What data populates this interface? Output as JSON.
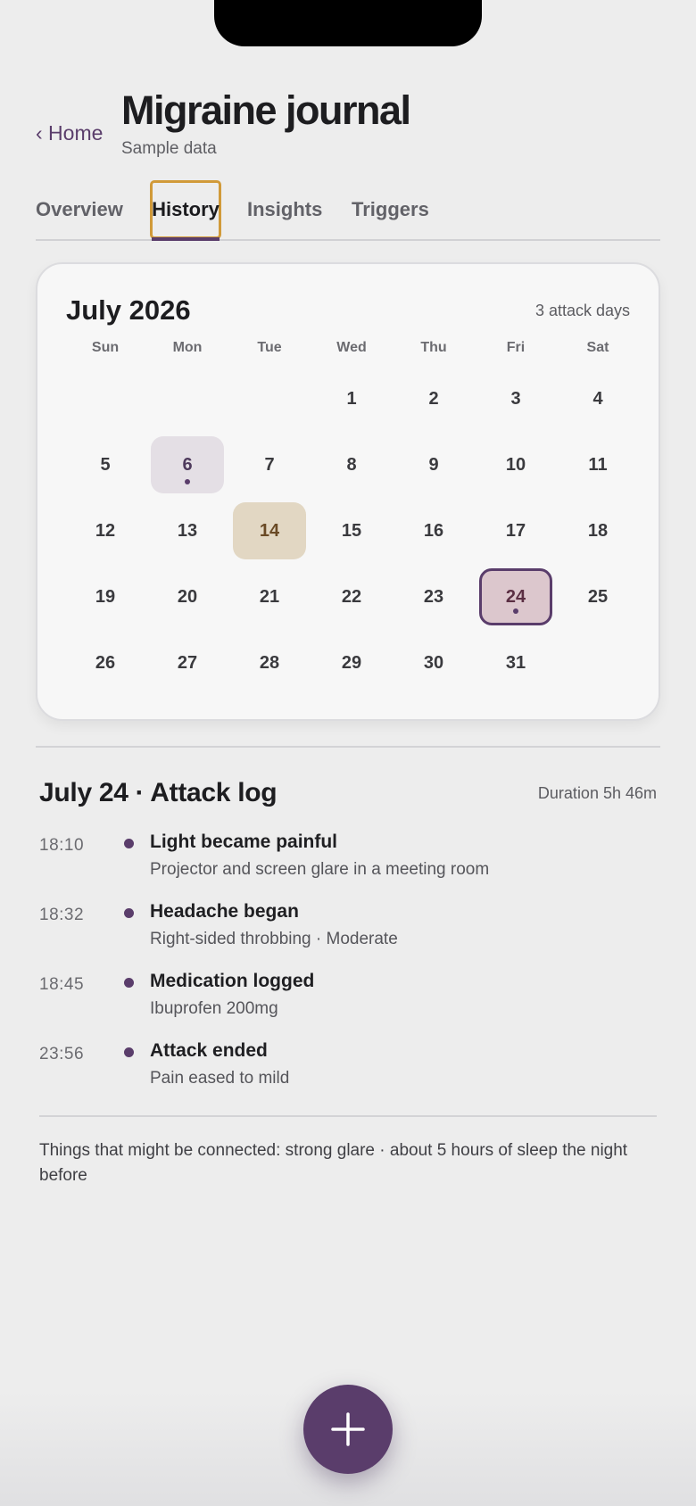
{
  "header": {
    "back_label": "‹ Home",
    "title": "Migraine journal",
    "subtitle": "Sample data"
  },
  "tabs": [
    {
      "label": "Overview",
      "active": false
    },
    {
      "label": "History",
      "active": true
    },
    {
      "label": "Insights",
      "active": false
    },
    {
      "label": "Triggers",
      "active": false
    }
  ],
  "calendar": {
    "month_label": "July 2026",
    "attack_count": "3 attack days",
    "weekdays": [
      "Sun",
      "Mon",
      "Tue",
      "Wed",
      "Thu",
      "Fri",
      "Sat"
    ],
    "weeks": [
      [
        "",
        "",
        "",
        "1",
        "2",
        "3",
        "4"
      ],
      [
        "5",
        "6",
        "7",
        "8",
        "9",
        "10",
        "11"
      ],
      [
        "12",
        "13",
        "14",
        "15",
        "16",
        "17",
        "18"
      ],
      [
        "19",
        "20",
        "21",
        "22",
        "23",
        "24",
        "25"
      ],
      [
        "26",
        "27",
        "28",
        "29",
        "30",
        "31",
        ""
      ]
    ],
    "attack_days": [
      "6",
      "24"
    ],
    "today": "14",
    "selected": "24"
  },
  "log": {
    "title": "July 24 · Attack log",
    "duration": "Duration 5h 46m",
    "events": [
      {
        "time": "18:10",
        "title": "Light became painful",
        "detail": "Projector and screen glare in a meeting room"
      },
      {
        "time": "18:32",
        "title": "Headache began",
        "detail": "Right-sided throbbing · Moderate"
      },
      {
        "time": "18:45",
        "title": "Medication logged",
        "detail": "Ibuprofen 200mg"
      },
      {
        "time": "23:56",
        "title": "Attack ended",
        "detail": "Pain eased to mild"
      }
    ]
  },
  "connected_note": "Things that might be connected: strong glare · about 5 hours of sleep the night before",
  "fab": {
    "icon": "plus-icon"
  },
  "colors": {
    "accent": "#5a3d6b",
    "focus_ring": "#d19a39",
    "today_bg": "#e2d7c3",
    "attack_bg": "#e4dfe5",
    "selected_bg": "#dcc7cd"
  }
}
